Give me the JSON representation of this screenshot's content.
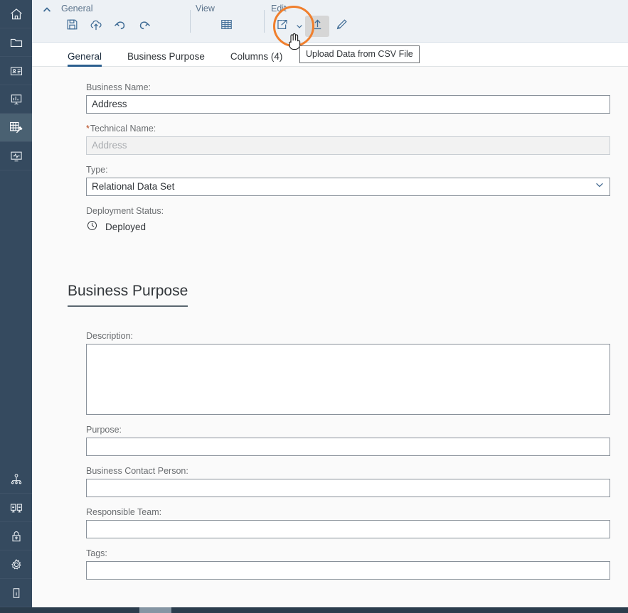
{
  "sidebar": {
    "items": [
      {
        "name": "home",
        "icon": "home-icon"
      },
      {
        "name": "folder",
        "icon": "folder-icon"
      },
      {
        "name": "business-card",
        "icon": "business-card-icon"
      },
      {
        "name": "chart-board",
        "icon": "chart-board-icon"
      },
      {
        "name": "data-modeling",
        "icon": "table-tools-icon",
        "active": true
      },
      {
        "name": "monitoring",
        "icon": "monitor-pulse-icon"
      }
    ],
    "bottom_items": [
      {
        "name": "data-sharing",
        "icon": "share-node-icon"
      },
      {
        "name": "connections",
        "icon": "server-rack-icon"
      },
      {
        "name": "security",
        "icon": "lock-icon"
      },
      {
        "name": "system-settings",
        "icon": "gear-icon"
      },
      {
        "name": "about",
        "icon": "info-icon"
      }
    ]
  },
  "toolbar": {
    "collapse_icon": "chevron-up-icon",
    "groups": [
      {
        "label": "General",
        "buttons": [
          {
            "name": "save",
            "icon": "save-icon"
          },
          {
            "name": "deploy",
            "icon": "cloud-upload-icon"
          },
          {
            "name": "undo",
            "icon": "undo-icon"
          },
          {
            "name": "redo",
            "icon": "redo-icon"
          }
        ]
      },
      {
        "label": "View",
        "buttons": [
          {
            "name": "data-preview",
            "icon": "grid-table-icon"
          }
        ]
      },
      {
        "label": "Edit",
        "buttons": [
          {
            "name": "export",
            "icon": "export-icon",
            "has_menu": true
          },
          {
            "name": "upload-csv",
            "icon": "upload-icon",
            "pressed": true
          },
          {
            "name": "edit-pen",
            "icon": "pen-icon"
          }
        ]
      }
    ]
  },
  "tooltip": {
    "text": "Upload Data from CSV File"
  },
  "tabs": [
    {
      "label": "General",
      "active": true
    },
    {
      "label": "Business Purpose",
      "active": false
    },
    {
      "label": "Columns (4)",
      "active": false
    }
  ],
  "form": {
    "business_name": {
      "label": "Business Name:",
      "value": "Address",
      "placeholder": ""
    },
    "technical_name": {
      "label": "Technical Name:",
      "required": true,
      "required_marker": "*",
      "value": "",
      "placeholder": "Address",
      "disabled": true
    },
    "type": {
      "label": "Type:",
      "value": "Relational Data Set",
      "options": [
        "Relational Data Set"
      ],
      "chevron": "chevron-down-icon"
    },
    "deployment_status": {
      "label": "Deployment Status:",
      "value": "Deployed",
      "icon": "clock-icon"
    }
  },
  "business_purpose": {
    "heading": "Business Purpose",
    "fields": [
      {
        "key": "description",
        "label": "Description:",
        "value": "",
        "placeholder": "",
        "multiline": true
      },
      {
        "key": "purpose",
        "label": "Purpose:",
        "value": "",
        "placeholder": "",
        "multiline": false
      },
      {
        "key": "contact",
        "label": "Business Contact Person:",
        "value": "",
        "placeholder": "",
        "multiline": false
      },
      {
        "key": "team",
        "label": "Responsible Team:",
        "value": "",
        "placeholder": "",
        "multiline": false
      },
      {
        "key": "tags",
        "label": "Tags:",
        "value": "",
        "placeholder": "",
        "multiline": false
      }
    ]
  },
  "colors": {
    "sidebar_bg": "#354a5f",
    "sidebar_active": "#4a6172",
    "toolbar_bg": "#edf1f5",
    "icon_blue": "#3d6a94",
    "accent_underline": "#2b5f8e",
    "annotation_orange": "#f07f2d",
    "required_red": "#b5451a",
    "content_bg": "#fafafa"
  }
}
